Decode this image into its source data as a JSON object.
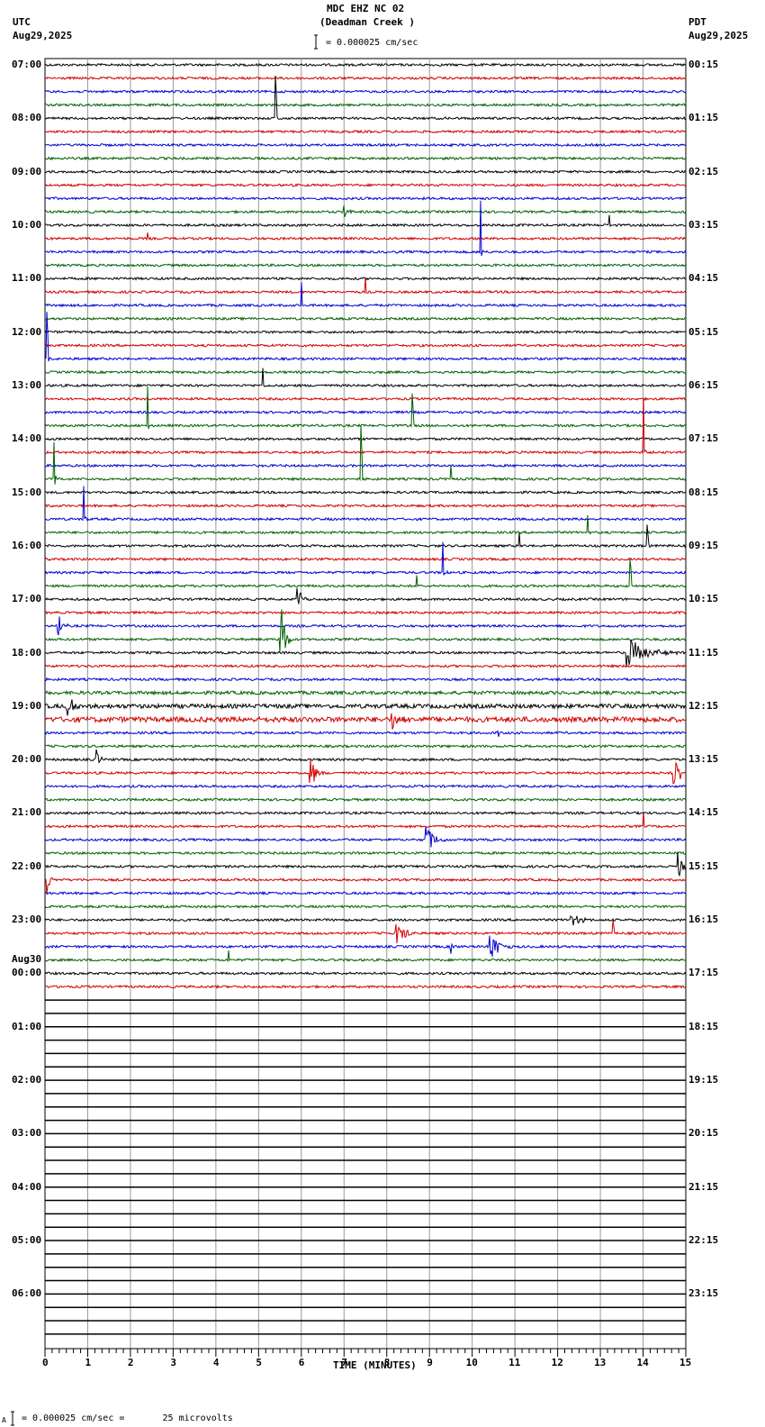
{
  "header": {
    "station": "MDC EHZ NC 02",
    "location": "(Deadman Creek )",
    "left_tz": "UTC",
    "left_date": "Aug29,2025",
    "right_tz": "PDT",
    "right_date": "Aug29,2025",
    "scale_text": "= 0.000025 cm/sec"
  },
  "footer": {
    "scale_text": "= 0.000025 cm/sec =       25 microvolts",
    "prefix": "A"
  },
  "chart_data": {
    "type": "line",
    "subtype": "helicorder",
    "title": "MDC EHZ NC 02 (Deadman Creek )",
    "xlabel": "TIME (MINUTES)",
    "xlim": [
      0,
      15
    ],
    "x_ticks": [
      "0",
      "1",
      "2",
      "3",
      "4",
      "5",
      "6",
      "7",
      "8",
      "9",
      "10",
      "11",
      "12",
      "13",
      "14",
      "15"
    ],
    "minor_tick_seconds": 10,
    "grid": true,
    "traces_per_hour": 4,
    "total_traces": 96,
    "traces_with_data": 70,
    "trace_colors": [
      "#000000",
      "#d00000",
      "#0000d0",
      "#006000"
    ],
    "empty_trace_color": "#000000",
    "left_labels": [
      "07:00",
      "08:00",
      "09:00",
      "10:00",
      "11:00",
      "12:00",
      "13:00",
      "14:00",
      "15:00",
      "16:00",
      "17:00",
      "18:00",
      "19:00",
      "20:00",
      "21:00",
      "22:00",
      "23:00",
      "00:00",
      "01:00",
      "02:00",
      "03:00",
      "04:00",
      "05:00",
      "06:00"
    ],
    "date_change_label": {
      "hour_index": 17,
      "text": "Aug30"
    },
    "right_labels": [
      "00:15",
      "01:15",
      "02:15",
      "03:15",
      "04:15",
      "05:15",
      "06:15",
      "07:15",
      "08:15",
      "09:15",
      "10:15",
      "11:15",
      "12:15",
      "13:15",
      "14:15",
      "15:15",
      "16:15",
      "17:15",
      "18:15",
      "19:15",
      "20:15",
      "21:15",
      "22:15",
      "23:15"
    ],
    "noisy_traces": [
      {
        "trace": 48,
        "level": 1.8
      },
      {
        "trace": 49,
        "level": 2.2
      },
      {
        "trace": 47,
        "level": 1.4
      }
    ],
    "events": [
      {
        "trace": 4,
        "minute": 5.4,
        "amp": 3.2,
        "dur": 3,
        "kind": "spike"
      },
      {
        "trace": 11,
        "minute": 7.0,
        "amp": 0.6,
        "dur": 8,
        "kind": "burst"
      },
      {
        "trace": 14,
        "minute": 10.2,
        "amp": 3.8,
        "dur": 4,
        "kind": "spike"
      },
      {
        "trace": 12,
        "minute": 13.2,
        "amp": 1.3,
        "dur": 2,
        "kind": "spike"
      },
      {
        "trace": 13,
        "minute": 2.4,
        "amp": 0.5,
        "dur": 2,
        "kind": "spike"
      },
      {
        "trace": 18,
        "minute": 6.0,
        "amp": 2.2,
        "dur": 2,
        "kind": "spike"
      },
      {
        "trace": 17,
        "minute": 7.5,
        "amp": 1.0,
        "dur": 2,
        "kind": "spike"
      },
      {
        "trace": 22,
        "minute": 0.05,
        "amp": 3.5,
        "dur": 3,
        "kind": "spike"
      },
      {
        "trace": 24,
        "minute": 5.1,
        "amp": 1.3,
        "dur": 2,
        "kind": "spike"
      },
      {
        "trace": 27,
        "minute": 2.4,
        "amp": 3.2,
        "dur": 3,
        "kind": "spike"
      },
      {
        "trace": 27,
        "minute": 8.6,
        "amp": 2.5,
        "dur": 3,
        "kind": "spike"
      },
      {
        "trace": 29,
        "minute": 14.0,
        "amp": 5.5,
        "dur": 4,
        "kind": "spike"
      },
      {
        "trace": 31,
        "minute": 0.2,
        "amp": 3.5,
        "dur": 6,
        "kind": "spike"
      },
      {
        "trace": 31,
        "minute": 7.4,
        "amp": 4.0,
        "dur": 3,
        "kind": "spike"
      },
      {
        "trace": 31,
        "minute": 9.5,
        "amp": 1.0,
        "dur": 3,
        "kind": "spike"
      },
      {
        "trace": 34,
        "minute": 0.9,
        "amp": 3.0,
        "dur": 4,
        "kind": "spike"
      },
      {
        "trace": 35,
        "minute": 12.7,
        "amp": 1.5,
        "dur": 3,
        "kind": "spike"
      },
      {
        "trace": 36,
        "minute": 14.1,
        "amp": 1.6,
        "dur": 3,
        "kind": "spike"
      },
      {
        "trace": 36,
        "minute": 11.1,
        "amp": 1.2,
        "dur": 2,
        "kind": "spike"
      },
      {
        "trace": 38,
        "minute": 9.3,
        "amp": 3.0,
        "dur": 5,
        "kind": "spike"
      },
      {
        "trace": 39,
        "minute": 13.7,
        "amp": 2.0,
        "dur": 4,
        "kind": "spike"
      },
      {
        "trace": 39,
        "minute": 8.7,
        "amp": 0.8,
        "dur": 3,
        "kind": "spike"
      },
      {
        "trace": 40,
        "minute": 5.9,
        "amp": 1.0,
        "dur": 12,
        "kind": "burst"
      },
      {
        "trace": 43,
        "minute": 5.5,
        "amp": 5.0,
        "dur": 10,
        "kind": "burst"
      },
      {
        "trace": 42,
        "minute": 0.3,
        "amp": 1.2,
        "dur": 10,
        "kind": "burst"
      },
      {
        "trace": 44,
        "minute": 13.6,
        "amp": 1.3,
        "dur": 45,
        "kind": "burst"
      },
      {
        "trace": 48,
        "minute": 0.5,
        "amp": 0.8,
        "dur": 25,
        "kind": "burst"
      },
      {
        "trace": 49,
        "minute": 8.1,
        "amp": 1.0,
        "dur": 15,
        "kind": "burst"
      },
      {
        "trace": 50,
        "minute": 10.6,
        "amp": 0.6,
        "dur": 5,
        "kind": "burst"
      },
      {
        "trace": 52,
        "minute": 1.2,
        "amp": 0.9,
        "dur": 8,
        "kind": "burst"
      },
      {
        "trace": 53,
        "minute": 6.2,
        "amp": 1.4,
        "dur": 15,
        "kind": "burst"
      },
      {
        "trace": 53,
        "minute": 14.7,
        "amp": 1.5,
        "dur": 20,
        "kind": "burst"
      },
      {
        "trace": 57,
        "minute": 14.0,
        "amp": 1.5,
        "dur": 3,
        "kind": "spike"
      },
      {
        "trace": 58,
        "minute": 8.9,
        "amp": 1.4,
        "dur": 20,
        "kind": "burst"
      },
      {
        "trace": 60,
        "minute": 14.8,
        "amp": 1.5,
        "dur": 12,
        "kind": "burst"
      },
      {
        "trace": 61,
        "minute": 0.05,
        "amp": 1.2,
        "dur": 8,
        "kind": "burst"
      },
      {
        "trace": 64,
        "minute": 12.3,
        "amp": 0.7,
        "dur": 20,
        "kind": "burst"
      },
      {
        "trace": 65,
        "minute": 8.2,
        "amp": 1.2,
        "dur": 20,
        "kind": "burst"
      },
      {
        "trace": 65,
        "minute": 13.3,
        "amp": 1.0,
        "dur": 2,
        "kind": "spike"
      },
      {
        "trace": 66,
        "minute": 10.4,
        "amp": 1.4,
        "dur": 20,
        "kind": "burst"
      },
      {
        "trace": 66,
        "minute": 9.5,
        "amp": 0.6,
        "dur": 8,
        "kind": "burst"
      },
      {
        "trace": 67,
        "minute": 4.3,
        "amp": 0.7,
        "dur": 3,
        "kind": "spike"
      }
    ]
  }
}
